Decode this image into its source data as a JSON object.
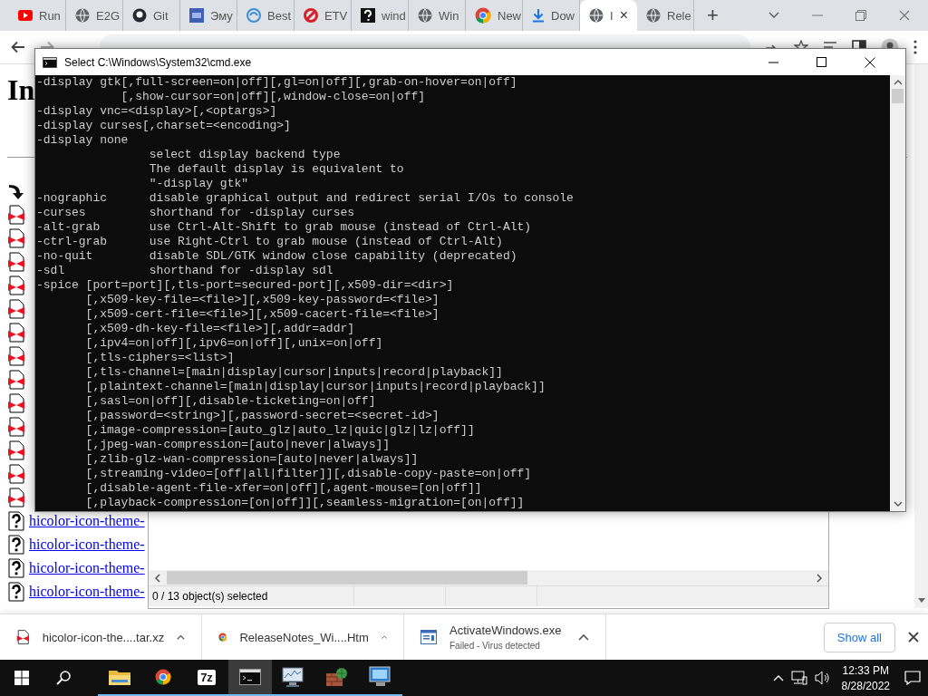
{
  "browser": {
    "tabs": [
      {
        "label": "Run",
        "kind": "play",
        "selected": false
      },
      {
        "label": "E2G",
        "kind": "globe",
        "selected": false
      },
      {
        "label": "Git",
        "kind": "round",
        "selected": false
      },
      {
        "label": "Эму",
        "kind": "square",
        "selected": false
      },
      {
        "label": "Best",
        "kind": "swirl",
        "selected": false
      },
      {
        "label": "ETV",
        "kind": "slash",
        "selected": false
      },
      {
        "label": "wind",
        "kind": "dark",
        "selected": false
      },
      {
        "label": "Win",
        "kind": "globe",
        "selected": false
      },
      {
        "label": "New",
        "kind": "ring",
        "selected": false
      },
      {
        "label": "Dow",
        "kind": "download",
        "selected": false
      },
      {
        "label": "I",
        "kind": "globe",
        "selected": true,
        "close": "×"
      },
      {
        "label": "Rele",
        "kind": "globe",
        "selected": false
      }
    ],
    "new_tab": "+",
    "page": {
      "heading": "In",
      "rows": [
        {
          "kind": "back"
        },
        {
          "kind": "archive"
        },
        {
          "kind": "archive"
        },
        {
          "kind": "archive"
        },
        {
          "kind": "archive"
        },
        {
          "kind": "archive"
        },
        {
          "kind": "archive"
        },
        {
          "kind": "archive"
        },
        {
          "kind": "archive"
        },
        {
          "kind": "archive"
        },
        {
          "kind": "archive"
        },
        {
          "kind": "archive"
        },
        {
          "kind": "archive"
        },
        {
          "kind": "archive"
        },
        {
          "kind": "unknown",
          "link": "hicolor-icon-theme-"
        },
        {
          "kind": "unknown",
          "link": "hicolor-icon-theme-"
        },
        {
          "kind": "unknown",
          "link": "hicolor-icon-theme-"
        },
        {
          "kind": "unknown",
          "link": "hicolor-icon-theme-"
        }
      ]
    }
  },
  "cmd": {
    "title": "Select C:\\Windows\\System32\\cmd.exe",
    "lines": [
      "-display gtk[,full-screen=on|off][,gl=on|off][,grab-on-hover=on|off]",
      "            [,show-cursor=on|off][,window-close=on|off]",
      "-display vnc=<display>[,<optargs>]",
      "-display curses[,charset=<encoding>]",
      "-display none",
      "                select display backend type",
      "                The default display is equivalent to",
      "                \"-display gtk\"",
      "-nographic      disable graphical output and redirect serial I/Os to console",
      "-curses         shorthand for -display curses",
      "-alt-grab       use Ctrl-Alt-Shift to grab mouse (instead of Ctrl-Alt)",
      "-ctrl-grab      use Right-Ctrl to grab mouse (instead of Ctrl-Alt)",
      "-no-quit        disable SDL/GTK window close capability (deprecated)",
      "-sdl            shorthand for -display sdl",
      "-spice [port=port][,tls-port=secured-port][,x509-dir=<dir>]",
      "       [,x509-key-file=<file>][,x509-key-password=<file>]",
      "       [,x509-cert-file=<file>][,x509-cacert-file=<file>]",
      "       [,x509-dh-key-file=<file>][,addr=addr]",
      "       [,ipv4=on|off][,ipv6=on|off][,unix=on|off]",
      "       [,tls-ciphers=<list>]",
      "       [,tls-channel=[main|display|cursor|inputs|record|playback]]",
      "       [,plaintext-channel=[main|display|cursor|inputs|record|playback]]",
      "       [,sasl=on|off][,disable-ticketing=on|off]",
      "       [,password=<string>][,password-secret=<secret-id>]",
      "       [,image-compression=[auto_glz|auto_lz|quic|glz|lz|off]]",
      "       [,jpeg-wan-compression=[auto|never|always]]",
      "       [,zlib-glz-wan-compression=[auto|never|always]]",
      "       [,streaming-video=[off|all|filter]][,disable-copy-paste=on|off]",
      "       [,disable-agent-file-xfer=on|off][,agent-mouse=[on|off]]",
      "       [,playback-compression=[on|off]][,seamless-migration=[on|off]]"
    ]
  },
  "archiver": {
    "status": "0 / 13 object(s) selected"
  },
  "downloads": {
    "items": [
      {
        "kind": "archive",
        "name": "hicolor-icon-the....tar.xz"
      },
      {
        "kind": "ring",
        "name": "ReleaseNotes_Wi....Htm"
      },
      {
        "kind": "window",
        "name": "ActivateWindows.exe",
        "status": "Failed - Virus detected"
      }
    ],
    "show_all": "Show all"
  },
  "taskbar": {
    "apps": [
      {
        "kind": "folder",
        "selected": false
      },
      {
        "kind": "ring",
        "selected": false
      },
      {
        "kind": "label",
        "label": "7z",
        "selected": false
      },
      {
        "kind": "terminal",
        "selected": true
      },
      {
        "kind": "chart",
        "selected": false
      },
      {
        "kind": "brick",
        "selected": false
      },
      {
        "kind": "monitor",
        "selected": false
      }
    ],
    "time": "12:33 PM",
    "date": "8/28/2022"
  }
}
